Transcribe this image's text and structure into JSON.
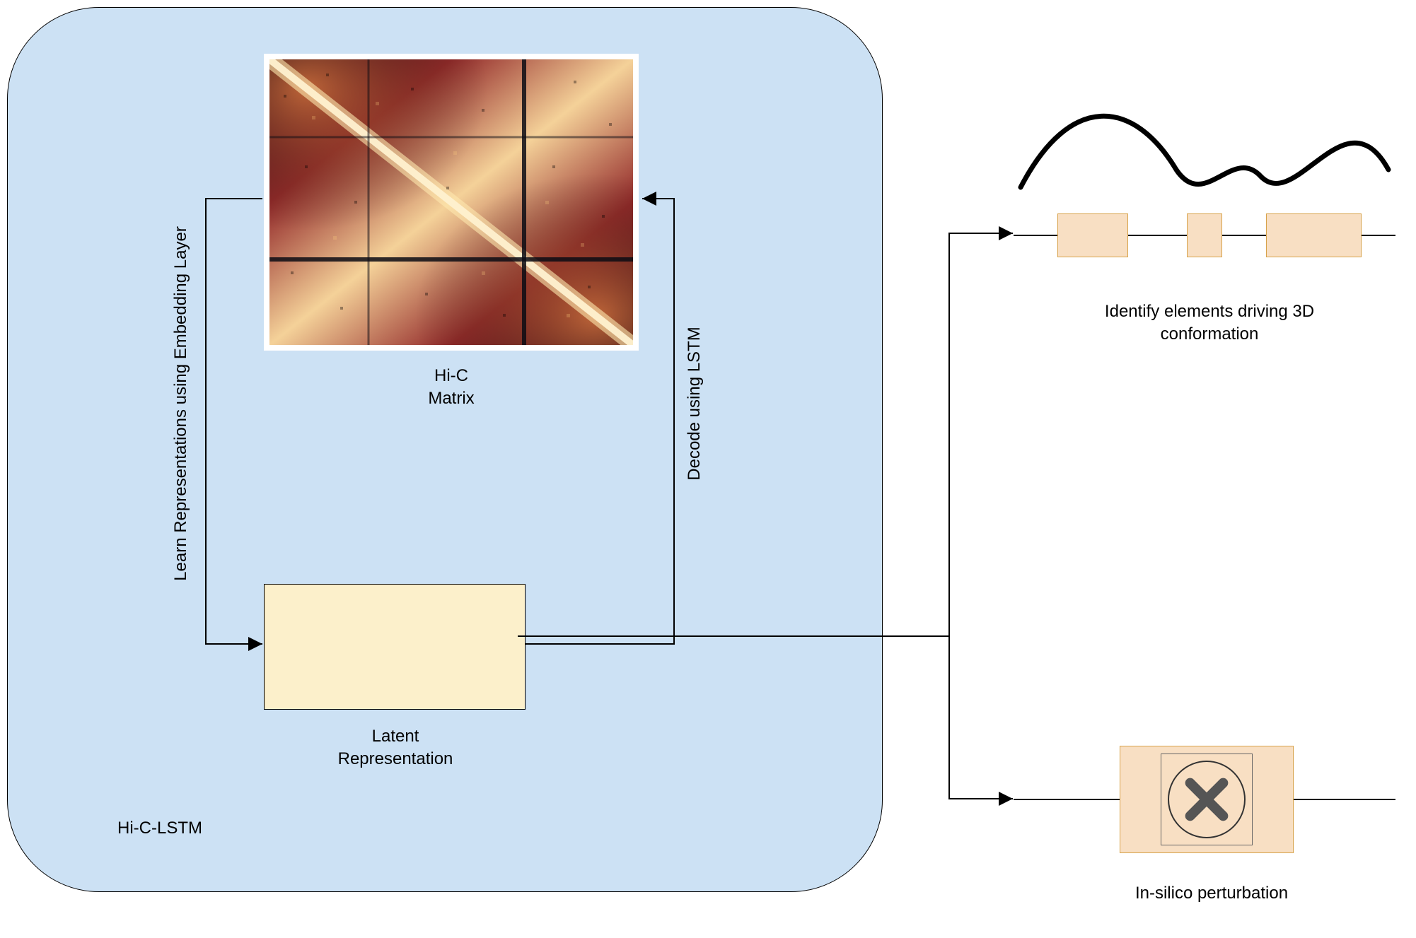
{
  "panel": {
    "model_name": "Hi-C-LSTM",
    "hic_matrix_label": "Hi-C\nMatrix",
    "latent_label": "Latent\nRepresentation",
    "left_arrow_label": "Learn Representations using Embedding\nLayer",
    "right_arrow_label": "Decode using LSTM"
  },
  "outputs": {
    "elements_label": "Identify elements driving 3D\nconformation",
    "insilico_label": "In-silico perturbation"
  },
  "colors": {
    "panel_bg": "#cce1f4",
    "box_fill": "#fcf0cb",
    "element_fill": "#f8dfc3",
    "element_border": "#d7a24a"
  }
}
